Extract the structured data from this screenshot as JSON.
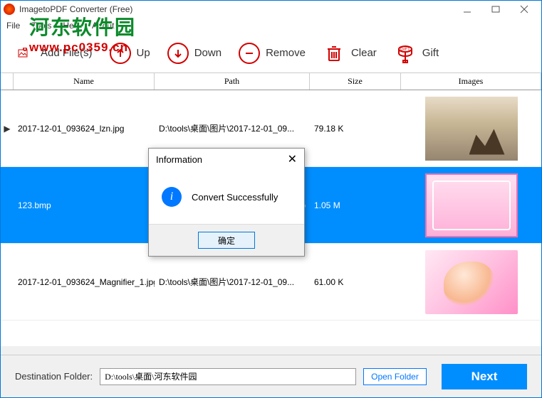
{
  "window": {
    "title": "ImagetoPDF Converter (Free)"
  },
  "menu": {
    "file": "File",
    "tools": "Tools",
    "help": "Help",
    "about": "About"
  },
  "watermark": {
    "line1": "河东软件园",
    "line2": "www.pc0359.cn"
  },
  "toolbar": {
    "add": "Add File(s)",
    "up": "Up",
    "down": "Down",
    "remove": "Remove",
    "clear": "Clear",
    "gift": "Gift"
  },
  "columns": {
    "name": "Name",
    "path": "Path",
    "size": "Size",
    "images": "Images"
  },
  "rows": [
    {
      "marker": "▶",
      "name": "2017-12-01_093624_lzn.jpg",
      "path": "D:\\tools\\桌面\\图片\\2017-12-01_09...",
      "size": "79.18 K",
      "selected": false,
      "thumb": "th1"
    },
    {
      "marker": "",
      "name": "123.bmp",
      "path": ".bmp",
      "size": "1.05 M",
      "selected": true,
      "thumb": "th2"
    },
    {
      "marker": "",
      "name": "2017-12-01_093624_Magnifier_1.jpg",
      "path": "D:\\tools\\桌面\\图片\\2017-12-01_09...",
      "size": "61.00 K",
      "selected": false,
      "thumb": "th3"
    }
  ],
  "bottom": {
    "label": "Destination Folder:",
    "value": "D:\\tools\\桌面\\河东软件园",
    "open": "Open Folder",
    "next": "Next"
  },
  "dialog": {
    "title": "Information",
    "message": "Convert Successfully",
    "ok": "确定"
  }
}
